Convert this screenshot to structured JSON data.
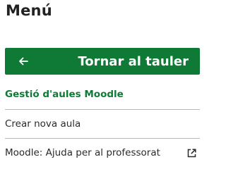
{
  "menu": {
    "title": "Menú"
  },
  "back_button": {
    "label": "Tornar al tauler",
    "icon": "arrow-left-icon"
  },
  "section": {
    "title": "Gestió d'aules Moodle"
  },
  "items": [
    {
      "label": "Crear nova aula"
    },
    {
      "label": "Moodle: Ajuda per al professorat",
      "icon": "external-link-icon"
    }
  ],
  "colors": {
    "accent": "#0f7a35",
    "divider": "#b8b8b8"
  }
}
